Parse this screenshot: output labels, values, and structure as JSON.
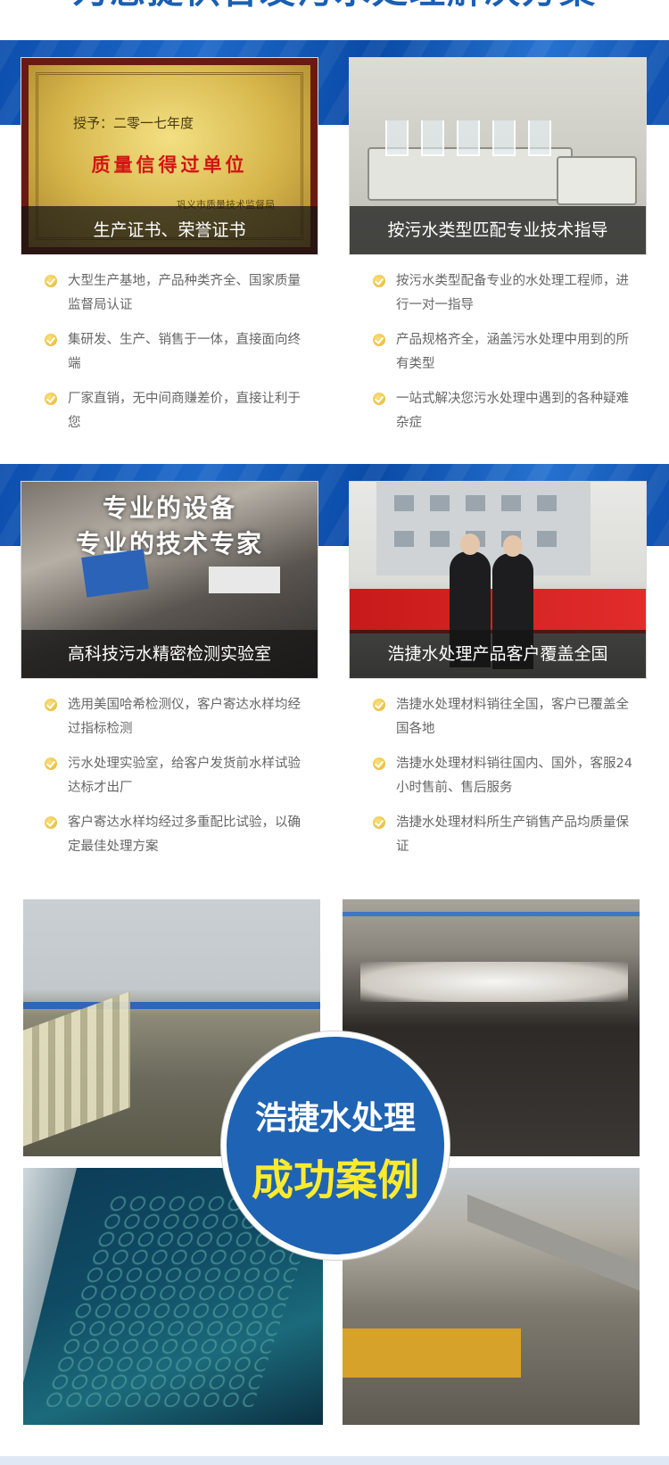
{
  "top_banner": {
    "text": "为您提供告发污水处理解决方案"
  },
  "cards": [
    {
      "caption": "生产证书、荣誉证书",
      "image": "certificate-image",
      "certificate": {
        "line1": "授予：二零一七年度",
        "line2": "质量信得过单位",
        "line3": "巩义市质量技术监督局"
      }
    },
    {
      "caption": "按污水类型匹配专业技术指导",
      "image": "lab-equipment-image"
    },
    {
      "caption": "高科技污水精密检测实验室",
      "image": "testing-equipment-image",
      "overlay": {
        "line1": "专业的设备",
        "line2": "专业的技术专家"
      }
    },
    {
      "caption": "浩捷水处理产品客户覆盖全国",
      "image": "customer-handshake-image"
    }
  ],
  "bullets": {
    "group1": [
      "大型生产基地，产品种类齐全、国家质量监督局认证",
      "集研发、生产、销售于一体，直接面向终端",
      "厂家直销，无中间商赚差价，直接让利于您"
    ],
    "group2": [
      "按污水类型配备专业的水处理工程师，进行一对一指导",
      "产品规格齐全，涵盖污水处理中用到的所有类型",
      "一站式解决您污水处理中遇到的各种疑难杂症"
    ],
    "group3": [
      "选用美国哈希检测仪，客户寄达水样均经过指标检测",
      "污水处理实验室，给客户发货前水样试验达标才出厂",
      "客户寄达水样均经过多重配比试验，以确定最佳处理方案"
    ],
    "group4": [
      "浩捷水处理材料销往全国，客户已覆盖全国各地",
      "浩捷水处理材料销往国内、国外，客服24小时售前、售后服务",
      "浩捷水处理材料所生产销售产品均质量保证"
    ]
  },
  "cases": {
    "title_line1": "浩捷水处理",
    "title_line2": "成功案例",
    "colors": {
      "circle": "#1f63b4",
      "highlight": "#ffeb2e"
    }
  },
  "colors": {
    "brand_blue": "#1a5fb4",
    "bullet_gold": "#e3b52a",
    "text_gray": "#666666"
  }
}
